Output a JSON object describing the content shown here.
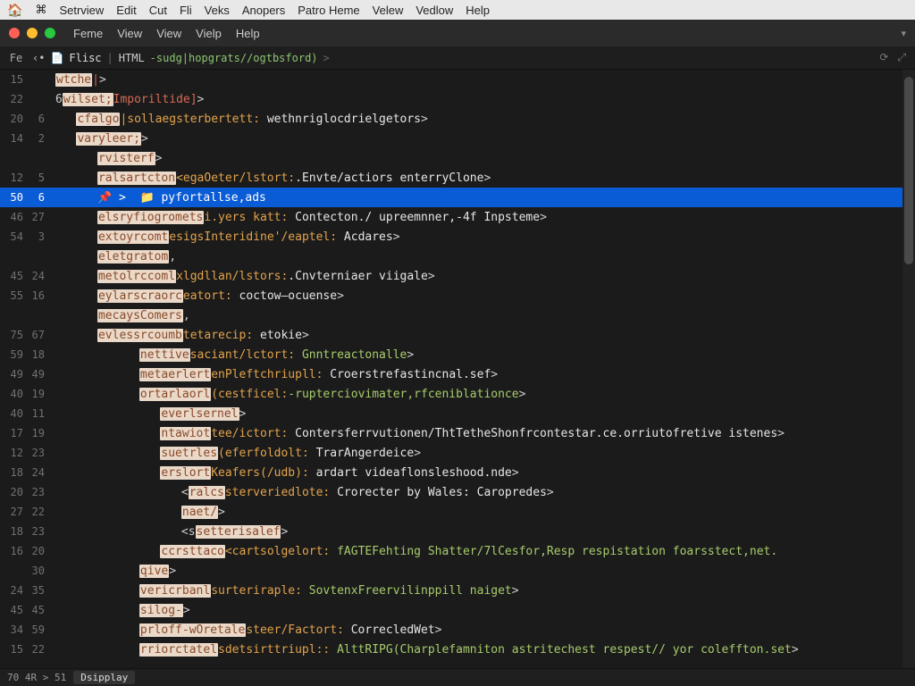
{
  "os_menu": [
    "Setrview",
    "Edit",
    "Cut",
    "Fli",
    "Veks",
    "Anopers",
    "Patro Heme",
    "Velew",
    "Vedlow",
    "Help"
  ],
  "app_menu": [
    "Feme",
    "View",
    "View",
    "Vielp",
    "Help"
  ],
  "tabrow": {
    "left_label": "Fe",
    "nav_back": "‹•",
    "file_name": "Flisc",
    "lang_tag": "HTML",
    "path_token": "-sudg|hopgrats//ogtbsford)",
    "chev": ">"
  },
  "right_icons": {
    "a": "⟳",
    "b": "⤢"
  },
  "statusbar": {
    "pos": "70  4R > 51",
    "tab": "Dsipplay"
  },
  "lines": [
    {
      "a": "15",
      "b": "",
      "indent": 0,
      "tokens": [
        {
          "t": "tag-bg",
          "v": "wtche"
        },
        {
          "t": "tag",
          "v": "|"
        },
        {
          "t": "br",
          "v": ">"
        }
      ]
    },
    {
      "a": "22",
      "b": "",
      "indent": 0,
      "tokens": [
        {
          "t": "br",
          "v": "6"
        },
        {
          "t": "tag-bg",
          "v": "wilset;"
        },
        {
          "t": "tag",
          "v": "Imporiltide]"
        },
        {
          "t": "br",
          "v": ">"
        }
      ]
    },
    {
      "a": "20",
      "b": "6",
      "indent": 1,
      "tokens": [
        {
          "t": "tag-bg",
          "v": "cfalgo"
        },
        {
          "t": "attr",
          "v": "|sollaegsterbertett:"
        },
        {
          "t": "white",
          "v": " wethnriglocdrielgetors"
        },
        {
          "t": "br",
          "v": ">"
        }
      ]
    },
    {
      "a": "14",
      "b": "2",
      "indent": 1,
      "tokens": [
        {
          "t": "tag-bg",
          "v": "varyleer;"
        },
        {
          "t": "br",
          "v": ">"
        }
      ]
    },
    {
      "a": "",
      "b": "",
      "indent": 2,
      "tokens": [
        {
          "t": "tag-bg",
          "v": "rvisterf"
        },
        {
          "t": "br",
          "v": ">"
        }
      ]
    },
    {
      "a": "12",
      "b": "5",
      "indent": 2,
      "tokens": [
        {
          "t": "tag-bg",
          "v": "ralsartcton"
        },
        {
          "t": "attr",
          "v": "<egaOeter/lstort:"
        },
        {
          "t": "white",
          "v": ".Envte/actiors enterryClone"
        },
        {
          "t": "br",
          "v": ">"
        }
      ]
    },
    {
      "a": "50",
      "b": "6",
      "indent": 2,
      "selected": true,
      "tokens": [
        {
          "t": "sel",
          "v": "📌 >  📁 pyfortallse,ads"
        }
      ]
    },
    {
      "a": "46",
      "b": "27",
      "indent": 2,
      "tokens": [
        {
          "t": "tag-bg",
          "v": "elsryfiogromets"
        },
        {
          "t": "attr",
          "v": "i.yers katt:"
        },
        {
          "t": "white",
          "v": " Contecton./ upreemnner,-4f Inpsteme"
        },
        {
          "t": "br",
          "v": ">"
        }
      ]
    },
    {
      "a": "54",
      "b": "3",
      "indent": 2,
      "tokens": [
        {
          "t": "tag-bg",
          "v": "extoyrcomt"
        },
        {
          "t": "attr",
          "v": "esigsInteridine'/eaptel:"
        },
        {
          "t": "white",
          "v": " Acdares"
        },
        {
          "t": "br",
          "v": ">"
        }
      ]
    },
    {
      "a": "",
      "b": "",
      "indent": 2,
      "tokens": [
        {
          "t": "tag-bg",
          "v": "eletgratom"
        },
        {
          "t": "br",
          "v": ","
        }
      ]
    },
    {
      "a": "45",
      "b": "24",
      "indent": 2,
      "tokens": [
        {
          "t": "tag-bg",
          "v": "metolrccoml"
        },
        {
          "t": "attr",
          "v": "xlgdllan/lstors:"
        },
        {
          "t": "white",
          "v": ".Cnvterniaer viigale"
        },
        {
          "t": "br",
          "v": ">"
        }
      ]
    },
    {
      "a": "55",
      "b": "16",
      "indent": 2,
      "tokens": [
        {
          "t": "tag-bg",
          "v": "eylarscraorc"
        },
        {
          "t": "attr",
          "v": "eatort:"
        },
        {
          "t": "white",
          "v": " coctow–ocuense"
        },
        {
          "t": "br",
          "v": ">"
        }
      ]
    },
    {
      "a": "",
      "b": "",
      "indent": 2,
      "tokens": [
        {
          "t": "tag-bg",
          "v": "mecaysComers"
        },
        {
          "t": "br",
          "v": ","
        }
      ]
    },
    {
      "a": "75",
      "b": "67",
      "indent": 2,
      "tokens": [
        {
          "t": "tag-bg",
          "v": "evlessrcoumb"
        },
        {
          "t": "attr",
          "v": "tetarecip:"
        },
        {
          "t": "white",
          "v": " etokie"
        },
        {
          "t": "br",
          "v": ">"
        }
      ]
    },
    {
      "a": "59",
      "b": "18",
      "indent": 4,
      "tokens": [
        {
          "t": "tag-bg",
          "v": "nettive"
        },
        {
          "t": "attr",
          "v": "saciant/lctort:"
        },
        {
          "t": "str",
          "v": " Gnntreactonalle"
        },
        {
          "t": "br",
          "v": ">"
        }
      ]
    },
    {
      "a": "49",
      "b": "49",
      "indent": 4,
      "tokens": [
        {
          "t": "tag-bg",
          "v": "metaerlert"
        },
        {
          "t": "attr",
          "v": "enPleftchriupll:"
        },
        {
          "t": "white",
          "v": " Croerstrefastincnal.sef"
        },
        {
          "t": "br",
          "v": ">"
        }
      ]
    },
    {
      "a": "40",
      "b": "19",
      "indent": 4,
      "tokens": [
        {
          "t": "tag-bg",
          "v": "ortarlaorl"
        },
        {
          "t": "attr",
          "v": "(cestficel:"
        },
        {
          "t": "str",
          "v": "-rupterciovimater,rfceniblationce"
        },
        {
          "t": "br",
          "v": ">"
        }
      ]
    },
    {
      "a": "40",
      "b": "11",
      "indent": 5,
      "tokens": [
        {
          "t": "tag-bg",
          "v": "everlsernel"
        },
        {
          "t": "br",
          "v": ">"
        }
      ]
    },
    {
      "a": "17",
      "b": "19",
      "indent": 5,
      "tokens": [
        {
          "t": "tag-bg",
          "v": "ntawiot"
        },
        {
          "t": "attr",
          "v": "tee/ictort:"
        },
        {
          "t": "white",
          "v": " Contersferrvutionen/ThtTetheShonfrcontestar.ce.orriutofretive istenes"
        },
        {
          "t": "br",
          "v": ">"
        }
      ]
    },
    {
      "a": "12",
      "b": "23",
      "indent": 5,
      "tokens": [
        {
          "t": "tag-bg",
          "v": "suetrles"
        },
        {
          "t": "attr",
          "v": "(eferfoldolt:"
        },
        {
          "t": "white",
          "v": " TrarAngerdeice"
        },
        {
          "t": "br",
          "v": ">"
        }
      ]
    },
    {
      "a": "18",
      "b": "24",
      "indent": 5,
      "tokens": [
        {
          "t": "tag-bg",
          "v": "erslort"
        },
        {
          "t": "attr",
          "v": "Keafers(/udb):"
        },
        {
          "t": "white",
          "v": " ardart videaflonsleshood.nde"
        },
        {
          "t": "br",
          "v": ">"
        }
      ]
    },
    {
      "a": "20",
      "b": "23",
      "indent": 6,
      "tokens": [
        {
          "t": "br",
          "v": "<"
        },
        {
          "t": "tag-bg",
          "v": "ralcs"
        },
        {
          "t": "attr",
          "v": "sterveriedlote:"
        },
        {
          "t": "white",
          "v": " Crorecter by Wales: Caropredes"
        },
        {
          "t": "br",
          "v": ">"
        }
      ]
    },
    {
      "a": "27",
      "b": "22",
      "indent": 6,
      "tokens": [
        {
          "t": "tag-bg",
          "v": "naet/"
        },
        {
          "t": "br",
          "v": ">"
        }
      ]
    },
    {
      "a": "18",
      "b": "23",
      "indent": 6,
      "tokens": [
        {
          "t": "br",
          "v": "<s"
        },
        {
          "t": "tag-bg",
          "v": "setterisalef"
        },
        {
          "t": "br",
          "v": ">"
        }
      ]
    },
    {
      "a": "16",
      "b": "20",
      "indent": 5,
      "tokens": [
        {
          "t": "tag-bg",
          "v": "ccrsttaco"
        },
        {
          "t": "attr",
          "v": "<cartsolgelort:"
        },
        {
          "t": "str",
          "v": " fAGTEFehting Shatter/7lCesfor,Resp respistation foarsstect,net."
        }
      ]
    },
    {
      "a": "",
      "b": "30",
      "indent": 4,
      "tokens": [
        {
          "t": "tag-bg",
          "v": "qive"
        },
        {
          "t": "br",
          "v": ">"
        }
      ]
    },
    {
      "a": "24",
      "b": "35",
      "indent": 4,
      "tokens": [
        {
          "t": "tag-bg",
          "v": "vericrbanl"
        },
        {
          "t": "attr",
          "v": "surteriraple:"
        },
        {
          "t": "str",
          "v": " SovtenxFreervilinppill naiget"
        },
        {
          "t": "br",
          "v": ">"
        }
      ]
    },
    {
      "a": "45",
      "b": "45",
      "indent": 4,
      "tokens": [
        {
          "t": "tag-bg",
          "v": "silog-"
        },
        {
          "t": "br",
          "v": ">"
        }
      ]
    },
    {
      "a": "34",
      "b": "59",
      "indent": 4,
      "tokens": [
        {
          "t": "tag-bg",
          "v": "prloff-wOretale"
        },
        {
          "t": "attr",
          "v": "steer/Factort:"
        },
        {
          "t": "white",
          "v": " CorrecledWet"
        },
        {
          "t": "br",
          "v": ">"
        }
      ]
    },
    {
      "a": "15",
      "b": "22",
      "indent": 4,
      "tokens": [
        {
          "t": "tag-bg",
          "v": "rriorctatel"
        },
        {
          "t": "attr",
          "v": "sdetsirttriupl::"
        },
        {
          "t": "str",
          "v": " AlttRIPG(Charplefamniton astritechest respest// yor coleffton.set"
        },
        {
          "t": "br",
          "v": ">"
        }
      ]
    }
  ]
}
